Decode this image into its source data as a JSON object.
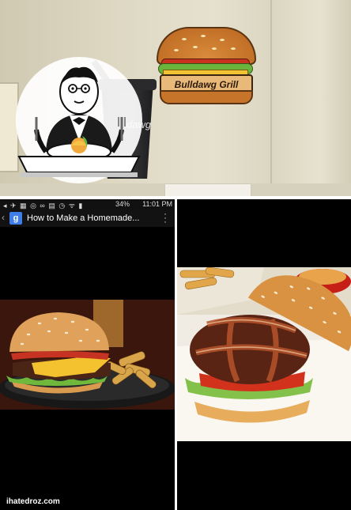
{
  "top_photo": {
    "sign_text": "Bulldawg Grill",
    "cup_text": "dawg"
  },
  "phone": {
    "status_time": "11:01 PM",
    "status_battery": "34%",
    "browser_badge": "g",
    "page_title": "How to Make a Homemade..."
  },
  "watermark": "ihatedroz.com",
  "colors": {
    "browser_accent": "#3f7ee8",
    "sign_bun": "#c6742a",
    "lettuce": "#6bb43c",
    "tomato": "#c9321e"
  }
}
